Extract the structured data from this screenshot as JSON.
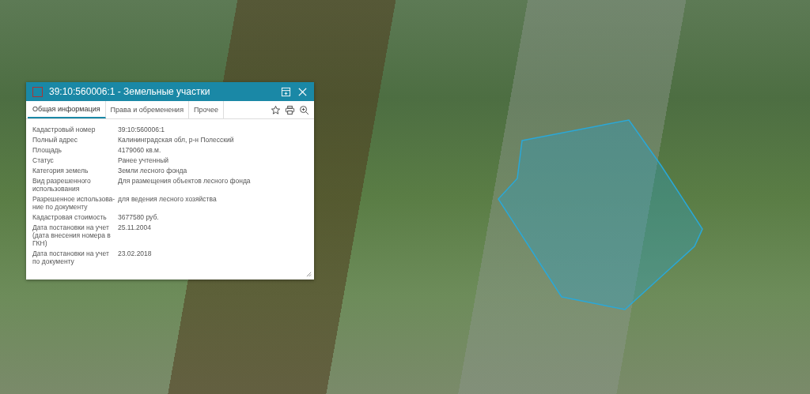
{
  "popup": {
    "title": "39:10:560006:1 - Земельные участки",
    "tabs": [
      {
        "label": "Общая информация",
        "selected": true
      },
      {
        "label": "Права и обременения",
        "selected": false
      },
      {
        "label": "Прочее",
        "selected": false
      }
    ],
    "fields": [
      {
        "label": "Кадастровый номер",
        "value": "39:10:560006:1"
      },
      {
        "label": "Полный адрес",
        "value": "Калининградская обл, р-н Полесский"
      },
      {
        "label": "Площадь",
        "value": "4179060 кв.м."
      },
      {
        "label": "Статус",
        "value": "Ранее учтенный"
      },
      {
        "label": "Категория земель",
        "value": "Земли лесного фонда"
      },
      {
        "label": "Вид разрешенного использования",
        "value": "Для размещения объектов лесного фонда"
      },
      {
        "label": "Разрешенное использова-ние по документу",
        "value": "для ведения лесного хозяйства"
      },
      {
        "label": "Кадастровая стоимость",
        "value": "3677580 руб."
      },
      {
        "label": "Дата постановки на учет (дата внесения номера в ГКН)",
        "value": "25.11.2004"
      },
      {
        "label": "Дата постановки на учет по документу",
        "value": "23.02.2018"
      }
    ]
  }
}
